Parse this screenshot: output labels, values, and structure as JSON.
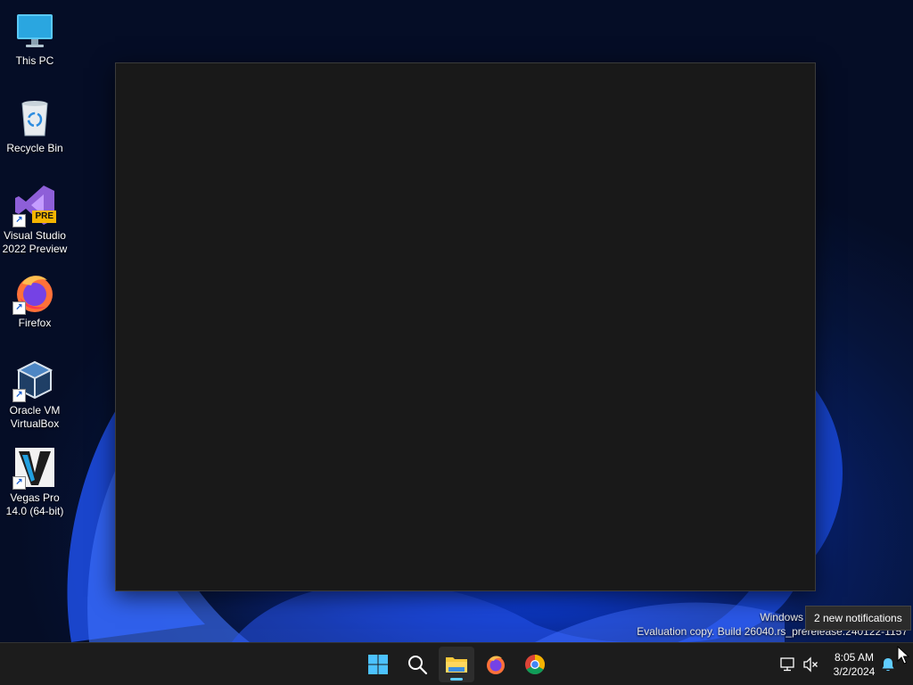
{
  "desktop": {
    "icons": [
      {
        "label": "This PC",
        "icon": "this-pc-icon"
      },
      {
        "label": "Recycle Bin",
        "icon": "recycle-bin-icon"
      },
      {
        "label": "Visual Studio 2022 Preview",
        "icon": "visual-studio-icon",
        "badge": "PRE",
        "shortcut": true
      },
      {
        "label": "Firefox",
        "icon": "firefox-icon",
        "shortcut": true
      },
      {
        "label": "Oracle VM VirtualBox",
        "icon": "virtualbox-icon",
        "shortcut": true
      },
      {
        "label": "Vegas Pro 14.0 (64-bit)",
        "icon": "vegas-pro-icon",
        "shortcut": true
      }
    ]
  },
  "watermark": {
    "line1": "Windows",
    "line2": "Evaluation copy. Build 26040.rs_prerelease.240122-1157"
  },
  "tooltip": {
    "text": "2 new notifications"
  },
  "taskbar": {
    "apps": [
      {
        "name": "start",
        "icon": "windows-start-icon"
      },
      {
        "name": "search",
        "icon": "search-icon"
      },
      {
        "name": "file-explorer",
        "icon": "file-explorer-icon",
        "active": true
      },
      {
        "name": "firefox",
        "icon": "firefox-icon"
      },
      {
        "name": "chrome",
        "icon": "chrome-icon"
      }
    ],
    "tray": {
      "time": "8:05 AM",
      "date": "3/2/2024",
      "icons": [
        "network-icon",
        "volume-muted-icon",
        "notification-bell-icon"
      ]
    }
  },
  "colors": {
    "taskbar_bg": "#1c1c1c",
    "window_bg": "#191919",
    "accent": "#60cdff"
  }
}
